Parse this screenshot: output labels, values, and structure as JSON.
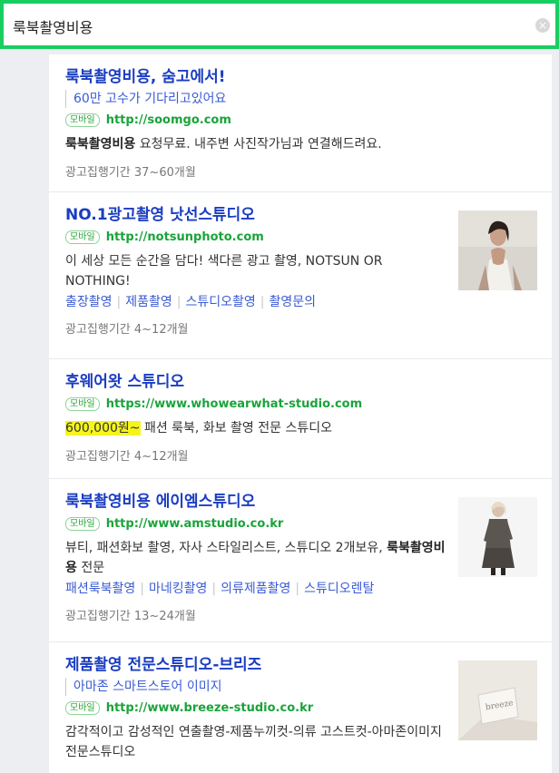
{
  "search": {
    "query": "룩북촬영비용",
    "clear_symbol": "×"
  },
  "ads": [
    {
      "title": "룩북촬영비용, 숨고에서!",
      "subtitle": "60만 고수가 기다리고있어요",
      "badge": "모바일",
      "url": "http://soomgo.com",
      "desc_bold": "룩북촬영비용",
      "desc": " 요청무료. 내주변 사진작가님과 연결해드려요.",
      "period": "광고집행기간 37~60개월"
    },
    {
      "title": "NO.1광고촬영 낫선스튜디오",
      "badge": "모바일",
      "url": "http://notsunphoto.com",
      "desc": "이 세상 모든 순간을 담다! 색다른 광고 촬영, NOTSUN OR NOTHING!",
      "links": [
        "출장촬영",
        "제품촬영",
        "스튜디오촬영",
        "촬영문의"
      ],
      "period": "광고집행기간 4~12개월"
    },
    {
      "title": "후웨어왓 스튜디오",
      "badge": "모바일",
      "url": "https://www.whowearwhat-studio.com",
      "price": "600,000원~",
      "desc": " 패션 룩북, 화보 촬영 전문 스튜디오",
      "period": "광고집행기간 4~12개월"
    },
    {
      "title": "룩북촬영비용 에이엠스튜디오",
      "badge": "모바일",
      "url": "http://www.amstudio.co.kr",
      "desc": "뷰티, 패션화보 촬영, 자사 스타일리스트, 스튜디오 2개보유, ",
      "desc_bold": "룩북촬영비용",
      "desc_tail": " 전문",
      "links": [
        "패션룩북촬영",
        "마네킹촬영",
        "의류제품촬영",
        "스튜디오렌탈"
      ],
      "period": "광고집행기간 13~24개월"
    },
    {
      "title": "제품촬영 전문스튜디오-브리즈",
      "subtitle": "아마존 스마트스토어 이미지",
      "badge": "모바일",
      "url": "http://www.breeze-studio.co.kr",
      "desc": "감각적이고 감성적인 연출촬영-제품누끼컷-의류 고스트컷-아마존이미지 전문스튜디오",
      "thumb_text": "breeze"
    }
  ],
  "colors": {
    "accent_green": "#19ce60",
    "title_blue": "#1a3dc1",
    "url_green": "#1aa33a",
    "highlight": "#f5f51c"
  }
}
